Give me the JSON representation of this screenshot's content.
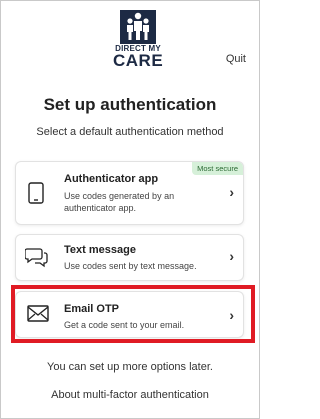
{
  "brand": {
    "line1": "DIRECT MY",
    "line2": "CARE"
  },
  "header": {
    "quit_label": "Quit"
  },
  "title": "Set up authentication",
  "subtitle": "Select a default authentication method",
  "methods": [
    {
      "name": "Authenticator app",
      "description": "Use codes generated by an authenticator app.",
      "badge": "Most secure",
      "icon": "phone-icon"
    },
    {
      "name": "Text message",
      "description": "Use codes sent by text message.",
      "icon": "chat-bubble-icon"
    },
    {
      "name": "Email OTP",
      "description": "Get a code sent to your email.",
      "icon": "envelope-icon",
      "highlighted": true
    }
  ],
  "footer": {
    "note": "You can set up more options later.",
    "link": "About multi-factor authentication"
  },
  "colors": {
    "highlight": "#e01b24",
    "badge_bg": "#d6f0d9",
    "brand": "#1d2a44"
  }
}
